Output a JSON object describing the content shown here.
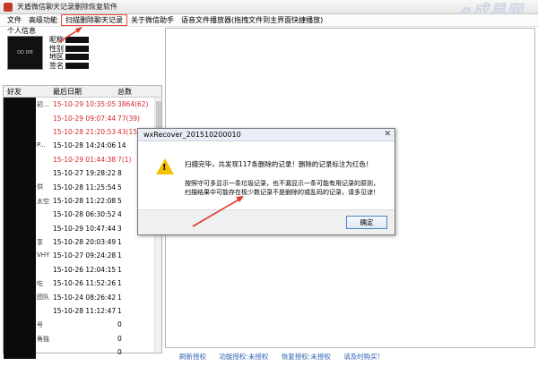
{
  "window": {
    "title": "天盾微信聊天记录删除恢复软件",
    "watermark": "e成易网"
  },
  "menu": [
    "文件",
    "高级功能",
    "扫描删除聊天记录",
    "关于微信助手",
    "语音文件播放器(拖拽文件到主界面快捷播放)"
  ],
  "profile": {
    "section_label": "个人信息",
    "avatar_text": "DO DIE",
    "fields": [
      "昵称",
      "性别",
      "地区",
      "签名"
    ]
  },
  "friends_list": {
    "headers": [
      "好友",
      "最后日期",
      "总数"
    ],
    "rows": [
      {
        "name_tail": "初...",
        "date": "15-10-29 10:35:05",
        "count": "3864(62)",
        "highlight": true
      },
      {
        "name_tail": "",
        "date": "15-10-29 09:07:44",
        "count": "77(39)",
        "highlight": true
      },
      {
        "name_tail": "",
        "date": "15-10-28 21:20:53",
        "count": "43(15)",
        "highlight": true
      },
      {
        "name_tail": "P...",
        "date": "15-10-28 14:24:06",
        "count": "14",
        "highlight": false
      },
      {
        "name_tail": "",
        "date": "15-10-29 01:44:38",
        "count": "7(1)",
        "highlight": true
      },
      {
        "name_tail": "",
        "date": "15-10-27 19:28:22",
        "count": "8",
        "highlight": false
      },
      {
        "name_tail": "供",
        "date": "15-10-28 11:25:54",
        "count": "5",
        "highlight": false
      },
      {
        "name_tail": "太空",
        "date": "15-10-28 11:22:08",
        "count": "5",
        "highlight": false
      },
      {
        "name_tail": "",
        "date": "15-10-28 06:30:52",
        "count": "4",
        "highlight": false
      },
      {
        "name_tail": "",
        "date": "15-10-29 10:47:44",
        "count": "3",
        "highlight": false
      },
      {
        "name_tail": "享",
        "date": "15-10-28 20:03:49",
        "count": "1",
        "highlight": false
      },
      {
        "name_tail": "VHY",
        "date": "15-10-27 09:24:28",
        "count": "1",
        "highlight": false
      },
      {
        "name_tail": "",
        "date": "15-10-26 12:04:15",
        "count": "1",
        "highlight": false
      },
      {
        "name_tail": "吃",
        "date": "15-10-26 11:52:26",
        "count": "1",
        "highlight": false
      },
      {
        "name_tail": "团队",
        "date": "15-10-24 08:26:42",
        "count": "1",
        "highlight": false
      },
      {
        "name_tail": "",
        "date": "15-10-28 11:12:47",
        "count": "1",
        "highlight": false
      },
      {
        "name_tail": "号",
        "date": "",
        "count": "0",
        "highlight": false
      },
      {
        "name_tail": "角独",
        "date": "",
        "count": "0",
        "highlight": false
      },
      {
        "name_tail": "",
        "date": "",
        "count": "0",
        "highlight": false
      }
    ]
  },
  "footer": {
    "links": [
      "刷新授权",
      "功能授权:未授权",
      "恢复授权:未授权",
      "请及时购买!"
    ]
  },
  "dialog": {
    "title": "wxRecover_201510200010",
    "message1": "扫描完毕，共发现117条删除的记录！删除的记录标注为红色！",
    "message2_line1": "按照守可多显示一条垃圾记录，也不漏显示一条可能有用记录的原则，",
    "message2_line2": "扫描结果中可能存在极少数记录不是删除的或乱码的记录，请多见谅！",
    "ok_label": "确定"
  },
  "colors": {
    "highlight_red": "#d42a2a",
    "link_blue": "#2a5db0",
    "arrow_red": "#e03a2e"
  }
}
